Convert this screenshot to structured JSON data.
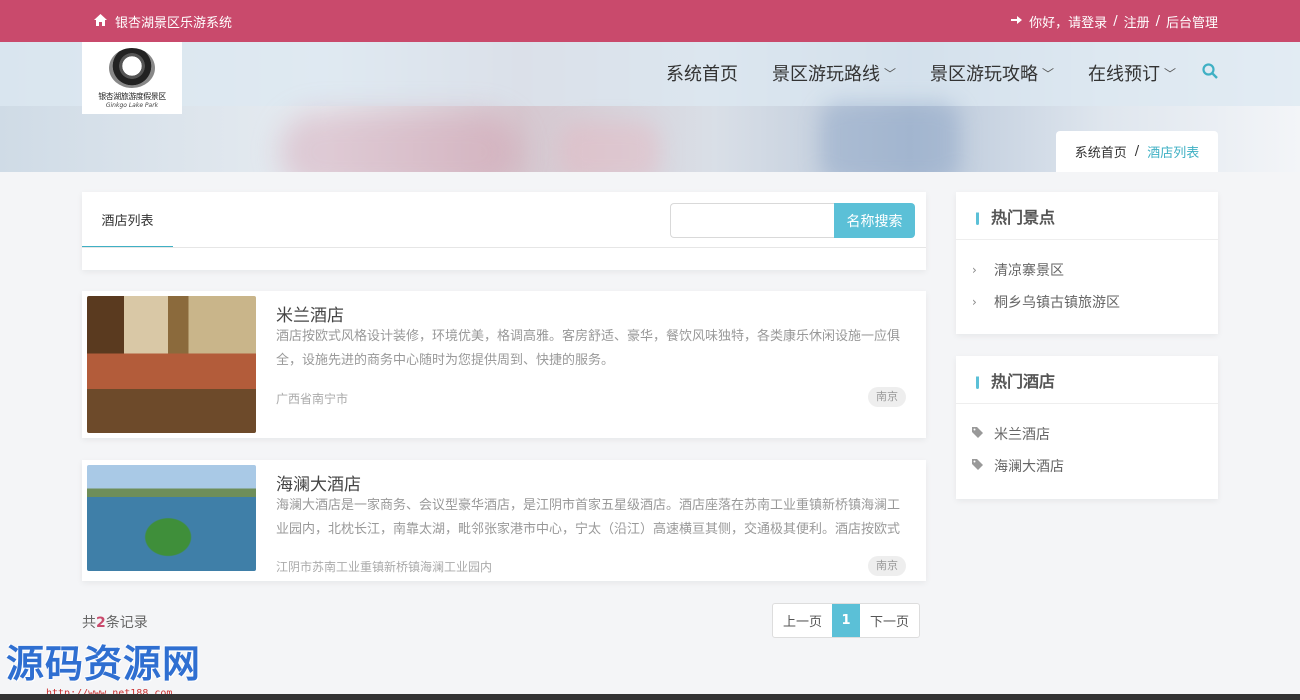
{
  "topbar": {
    "home_icon": "home-icon",
    "site_name": "银杏湖景区乐游系统",
    "login_icon": "sign-in-icon",
    "greeting": "你好，请登录",
    "register": "注册",
    "admin": "后台管理",
    "sep": "/"
  },
  "logo": {
    "text": "银杏湖旅游度假景区",
    "sub": "Ginkgo Lake Park"
  },
  "nav": {
    "items": [
      "系统首页",
      "景区游玩路线",
      "景区游玩攻略",
      "在线预订"
    ],
    "search_icon": "search-icon"
  },
  "breadcrumb": {
    "home": "系统首页",
    "sep": "/",
    "current": "酒店列表"
  },
  "list": {
    "tab": "酒店列表",
    "search_placeholder": "",
    "search_button": "名称搜索",
    "hotels": [
      {
        "name": "米兰酒店",
        "desc": "酒店按欧式风格设计装修，环境优美，格调高雅。客房舒适、豪华，餐饮风味独特，各类康乐休闲设施一应俱全，设施先进的商务中心随时为您提供周到、快捷的服务。",
        "address": "广西省南宁市",
        "city": "南京"
      },
      {
        "name": "海澜大酒店",
        "desc": "海澜大酒店是一家商务、会议型豪华酒店，是江阴市首家五星级酒店。酒店座落在苏南工业重镇新桥镇海澜工业园内，北枕长江，南靠太湖，毗邻张家港市中心，宁太（沿江）高速横亘其侧，交通极其便利。酒店按欧式",
        "address": "江阴市苏南工业重镇新桥镇海澜工业园内",
        "city": "南京"
      }
    ],
    "total_prefix": "共",
    "total_count": "2",
    "total_suffix": "条记录",
    "pager": {
      "prev": "上一页",
      "page": "1",
      "next": "下一页"
    }
  },
  "sidebar": {
    "spots_title": "热门景点",
    "spots": [
      "清凉寨景区",
      "桐乡乌镇古镇旅游区"
    ],
    "hotels_title": "热门酒店",
    "hotels": [
      "米兰酒店",
      "海澜大酒店"
    ]
  },
  "watermark": {
    "big": "源码资源网",
    "small": "http://www.net188.com"
  },
  "colors": {
    "topbar": "#c94a6c",
    "accent": "#5bc0d7"
  }
}
